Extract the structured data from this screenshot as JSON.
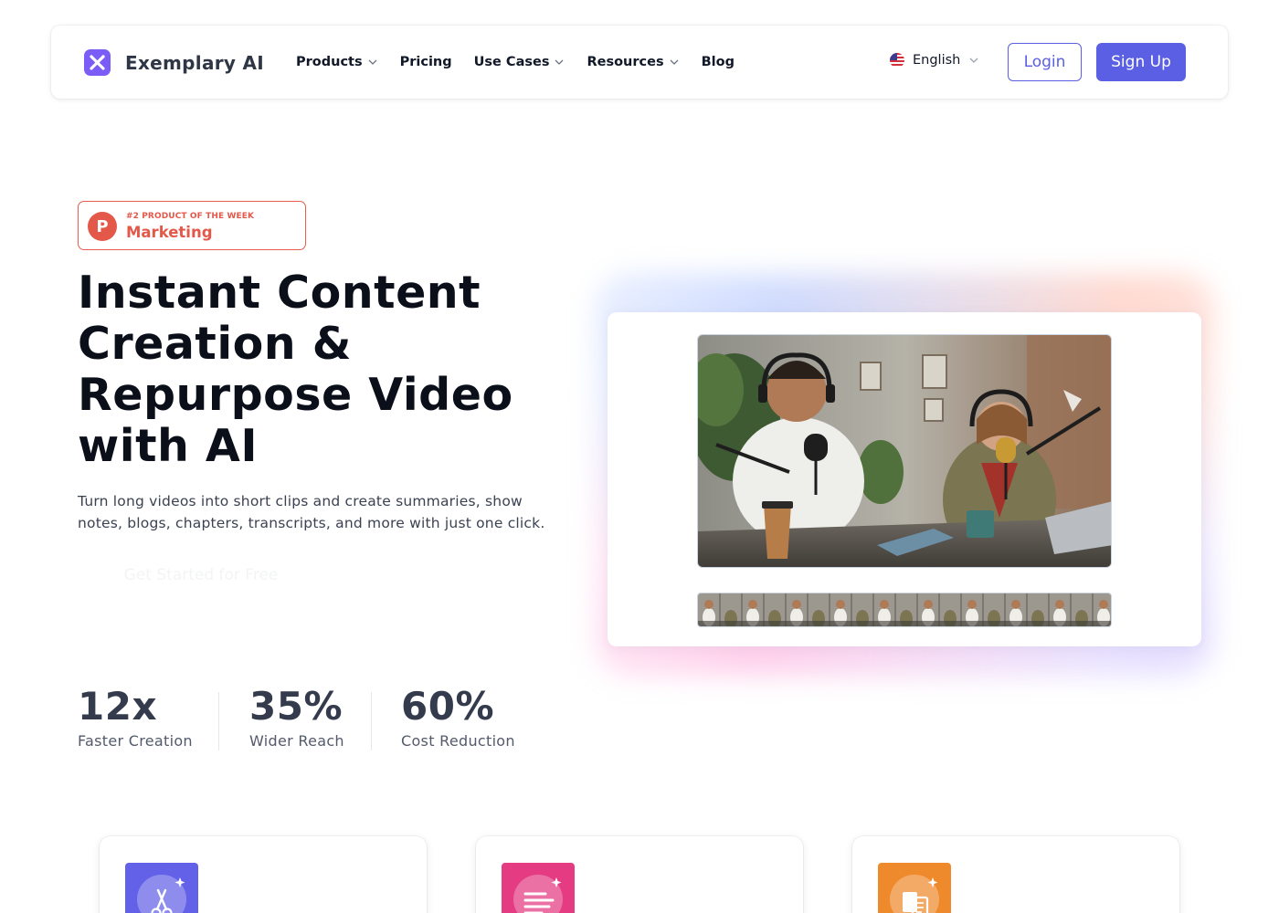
{
  "brand": {
    "name": "Exemplary AI",
    "accent": "#5b5fe3",
    "logo_color": "#7c5cf6"
  },
  "nav": {
    "items": [
      {
        "label": "Products",
        "has_dropdown": true
      },
      {
        "label": "Pricing",
        "has_dropdown": false
      },
      {
        "label": "Use Cases",
        "has_dropdown": true
      },
      {
        "label": "Resources",
        "has_dropdown": true
      },
      {
        "label": "Blog",
        "has_dropdown": false
      }
    ],
    "language": {
      "label": "English",
      "icon": "us-flag-icon"
    },
    "login_label": "Login",
    "signup_label": "Sign Up"
  },
  "hero": {
    "badge": {
      "logo_letter": "P",
      "eyebrow": "#2 PRODUCT OF THE WEEK",
      "category": "Marketing",
      "color": "#e4584a"
    },
    "title": "Instant Content Creation & Repurpose Video with AI",
    "subtitle": "Turn long videos into short clips and create summaries, show notes, blogs, chapters, transcripts, and more with just one click.",
    "cta_label": "Get Started for Free"
  },
  "stats": [
    {
      "value": "12x",
      "label": "Faster Creation"
    },
    {
      "value": "35%",
      "label": "Wider Reach"
    },
    {
      "value": "60%",
      "label": "Cost Reduction"
    }
  ],
  "features": [
    {
      "icon": "scissors-sparkle-icon",
      "color": "#6361e8"
    },
    {
      "icon": "text-lines-sparkle-icon",
      "color": "#e43b82"
    },
    {
      "icon": "document-sparkle-icon",
      "color": "#ef8a2c"
    }
  ]
}
